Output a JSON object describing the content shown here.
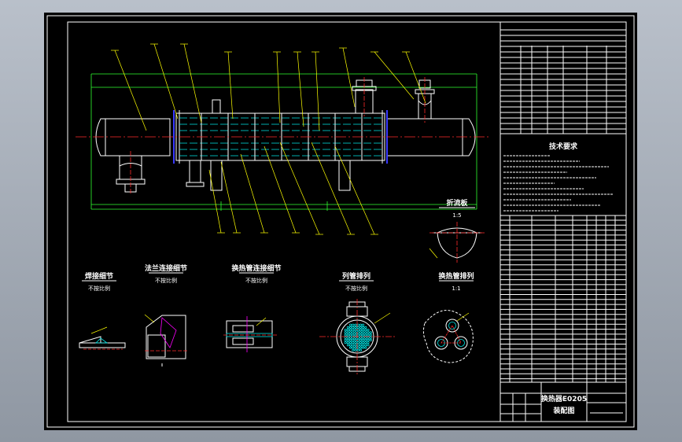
{
  "drawing": {
    "title_block": {
      "drawing_name": "换热器E0205",
      "drawing_type": "装配图"
    },
    "tech_requirements_title": "技术要求",
    "details": [
      {
        "title": "焊接细节",
        "scale": "不按比例"
      },
      {
        "title": "法兰连接细节",
        "scale": "不按比例"
      },
      {
        "title": "换热管连接细节",
        "scale": "不按比例"
      },
      {
        "title": "列管排列",
        "scale": "不按比例"
      },
      {
        "title": "换热管排列",
        "scale": "1:1"
      }
    ],
    "baffle": {
      "title": "折流板",
      "scale": "1:5"
    },
    "colors": {
      "background": "#000000",
      "lines": "#ffffff",
      "leaders": "#ffff00",
      "centerlines": "#ff2a2a",
      "tubes": "#00e5e5",
      "tubesheet": "#3a3aff"
    }
  }
}
